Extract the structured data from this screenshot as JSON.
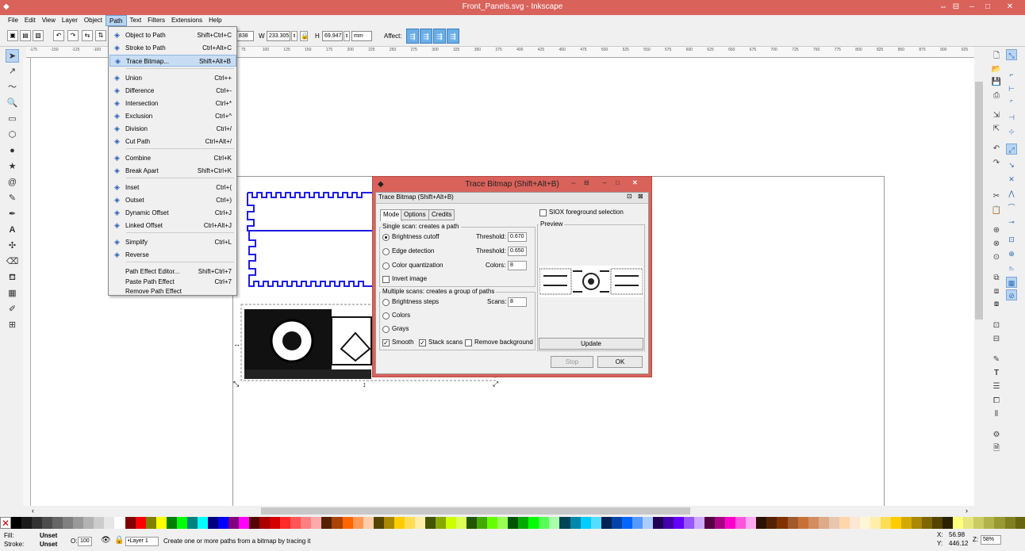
{
  "window": {
    "title": "Front_Panels.svg - Inkscape",
    "controls": [
      "⇔",
      "⊟",
      "–",
      "□",
      "✕"
    ]
  },
  "menubar": [
    "File",
    "Edit",
    "View",
    "Layer",
    "Object",
    "Path",
    "Text",
    "Filters",
    "Extensions",
    "Help"
  ],
  "toolbar": {
    "x_value": "838",
    "w_label": "W",
    "w_value": "233.305",
    "h_label": "H",
    "h_value": "69.947",
    "unit": "mm",
    "affect_label": "Affect:"
  },
  "ruler_ticks": [
    "-175",
    "-150",
    "-125",
    "-100",
    "-75",
    "-50",
    "-25",
    "0",
    "25",
    "50",
    "75",
    "100",
    "125",
    "150",
    "175",
    "200",
    "225",
    "250",
    "275",
    "300",
    "325",
    "350",
    "375",
    "400",
    "425",
    "450",
    "475",
    "500",
    "525",
    "550",
    "575",
    "600",
    "625",
    "650",
    "675",
    "700",
    "725",
    "750",
    "775",
    "800",
    "825",
    "850",
    "875",
    "900",
    "925",
    "950",
    "975",
    "1000",
    "1025",
    "1050"
  ],
  "path_menu": {
    "items": [
      {
        "label": "Object to Path",
        "shortcut": "Shift+Ctrl+C",
        "icon": "object-to-path-icon"
      },
      {
        "label": "Stroke to Path",
        "shortcut": "Ctrl+Alt+C",
        "icon": "stroke-to-path-icon"
      },
      {
        "label": "Trace Bitmap...",
        "shortcut": "Shift+Alt+B",
        "icon": "trace-bitmap-icon"
      },
      {
        "label": "Union",
        "shortcut": "Ctrl++",
        "icon": "union-icon"
      },
      {
        "label": "Difference",
        "shortcut": "Ctrl+-",
        "icon": "difference-icon"
      },
      {
        "label": "Intersection",
        "shortcut": "Ctrl+*",
        "icon": "intersection-icon"
      },
      {
        "label": "Exclusion",
        "shortcut": "Ctrl+^",
        "icon": "exclusion-icon"
      },
      {
        "label": "Division",
        "shortcut": "Ctrl+/",
        "icon": "division-icon"
      },
      {
        "label": "Cut Path",
        "shortcut": "Ctrl+Alt+/",
        "icon": "cut-path-icon"
      },
      {
        "label": "Combine",
        "shortcut": "Ctrl+K",
        "icon": "combine-icon"
      },
      {
        "label": "Break Apart",
        "shortcut": "Shift+Ctrl+K",
        "icon": "break-apart-icon"
      },
      {
        "label": "Inset",
        "shortcut": "Ctrl+(",
        "icon": "inset-icon"
      },
      {
        "label": "Outset",
        "shortcut": "Ctrl+)",
        "icon": "outset-icon"
      },
      {
        "label": "Dynamic Offset",
        "shortcut": "Ctrl+J",
        "icon": "dynamic-offset-icon"
      },
      {
        "label": "Linked Offset",
        "shortcut": "Ctrl+Alt+J",
        "icon": "linked-offset-icon"
      },
      {
        "label": "Simplify",
        "shortcut": "Ctrl+L",
        "icon": "simplify-icon"
      },
      {
        "label": "Reverse",
        "shortcut": "",
        "icon": "reverse-icon"
      },
      {
        "label": "Path Effect Editor...",
        "shortcut": "Shift+Ctrl+7",
        "icon": ""
      },
      {
        "label": "Paste Path Effect",
        "shortcut": "Ctrl+7",
        "icon": ""
      },
      {
        "label": "Remove Path Effect",
        "shortcut": "",
        "icon": ""
      }
    ]
  },
  "dialog": {
    "title": "Trace Bitmap (Shift+Alt+B)",
    "inner_title": "Trace Bitmap (Shift+Alt+B)",
    "tabs": [
      "Mode",
      "Options",
      "Credits"
    ],
    "single_scan_title": "Single scan: creates a path",
    "brightness_cutoff": "Brightness cutoff",
    "edge_detection": "Edge detection",
    "color_quantization": "Color quantization",
    "threshold_label": "Threshold:",
    "threshold_1": "0.670",
    "threshold_2": "0.650",
    "colors_label": "Colors:",
    "colors_value": "8",
    "invert_image": "Invert image",
    "multiple_scans_title": "Multiple scans: creates a group of paths",
    "brightness_steps": "Brightness steps",
    "scans_label": "Scans:",
    "scans_value": "8",
    "colors": "Colors",
    "grays": "Grays",
    "smooth": "Smooth",
    "stack_scans": "Stack scans",
    "remove_background": "Remove background",
    "siox": "SIOX foreground selection",
    "preview": "Preview",
    "update": "Update",
    "stop": "Stop",
    "ok": "OK"
  },
  "status": {
    "fill_label": "Fill:",
    "fill_value": "Unset",
    "stroke_label": "Stroke:",
    "stroke_value": "Unset",
    "opacity_label": "O:",
    "opacity_value": "100",
    "layer": "•Layer 1",
    "message": "Create one or more paths from a bitmap by tracing it",
    "x_label": "X:",
    "x_value": "56.98",
    "y_label": "Y:",
    "y_value": "446.12",
    "zoom_label": "Z:",
    "zoom_value": "58%"
  },
  "palette": [
    "#000000",
    "#1a1a1a",
    "#333333",
    "#4d4d4d",
    "#666666",
    "#808080",
    "#999999",
    "#b3b3b3",
    "#cccccc",
    "#e6e6e6",
    "#ffffff",
    "#800000",
    "#ff0000",
    "#808000",
    "#ffff00",
    "#008000",
    "#00ff00",
    "#008080",
    "#00ffff",
    "#000080",
    "#0000ff",
    "#800080",
    "#ff00ff",
    "#550000",
    "#aa0000",
    "#d40000",
    "#ff2a2a",
    "#ff5555",
    "#ff8080",
    "#ffaaaa",
    "#552200",
    "#aa4400",
    "#ff6600",
    "#ff9955",
    "#ffccaa",
    "#554400",
    "#aa8800",
    "#ffcc00",
    "#ffdd55",
    "#ffeeaa",
    "#445500",
    "#88aa00",
    "#ccff00",
    "#ddff55",
    "#225500",
    "#44aa00",
    "#66ff00",
    "#99ff55",
    "#005500",
    "#00aa00",
    "#00ff00",
    "#55ff55",
    "#aaffaa",
    "#004455",
    "#0088aa",
    "#00ccff",
    "#55ddff",
    "#002255",
    "#0044aa",
    "#0066ff",
    "#5599ff",
    "#aaccff",
    "#220055",
    "#4400aa",
    "#6600ff",
    "#9955ff",
    "#ccaaff",
    "#550044",
    "#aa0088",
    "#ff00cc",
    "#ff55dd",
    "#ffaaee",
    "#2b1100",
    "#552200",
    "#803300",
    "#a05a2c",
    "#c87137",
    "#d38d5f",
    "#deaa87",
    "#e9c6af",
    "#ffd5aa",
    "#ffe6d5",
    "#fff6d5",
    "#ffeeaa",
    "#ffdd55",
    "#ffcc00",
    "#d4aa00",
    "#aa8800",
    "#806600",
    "#554400",
    "#2b2200",
    "#ffff80",
    "#e6e680",
    "#cccc66",
    "#b3b34d",
    "#999933",
    "#808020",
    "#666610"
  ]
}
